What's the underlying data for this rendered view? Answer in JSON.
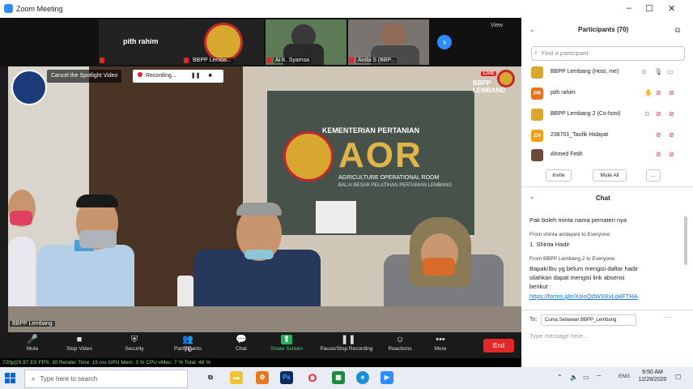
{
  "window": {
    "title": "Zoom Meeting",
    "minimize": "–",
    "maximize": "☐",
    "close": "✕"
  },
  "strip": {
    "tiles": [
      {
        "name": "pith rahim"
      },
      {
        "name": "BBPP Lemba..."
      },
      {
        "name": "Ai K. Syamsa"
      },
      {
        "name": "Anda S (BBP..."
      }
    ],
    "view_label": "View",
    "next_arrow": "›"
  },
  "main": {
    "spotlight_label": "Cancel the Spotlight Video",
    "recording_label": "Recording...",
    "live_badge": "LIVE",
    "brand": "BBPP LEMBANG",
    "speaker_name": "BBPP Lembang",
    "banner": {
      "ministry": "KEMENTERIAN PERTANIAN",
      "aor": "AOR",
      "subtitle": "AGRICULTURE OPERATIONAL ROOM",
      "location": "BALAI BESAR PELATIHAN PERTANIAN LEMBANG"
    }
  },
  "toolbar": {
    "items": [
      {
        "label": "Mute",
        "icon": "🎤"
      },
      {
        "label": "Stop Video",
        "icon": "■"
      },
      {
        "label": "Security",
        "icon": "⛨"
      },
      {
        "label": "Participants",
        "icon": "👥",
        "count": "70"
      },
      {
        "label": "Chat",
        "icon": "💬"
      },
      {
        "label": "Share Screen",
        "icon": "⬆"
      },
      {
        "label": "Pause/Stop Recording",
        "icon": "❚❚"
      },
      {
        "label": "Reactions",
        "icon": "☺"
      },
      {
        "label": "More",
        "icon": "•••"
      }
    ],
    "end_label": "End"
  },
  "stats": "720p|29.97   EX  FPS:  30   Render Time:  15 ms   GPU Mem:  3 %   CPU vMec:  7 %   Total:  48 %",
  "participants": {
    "header": "Participants (70)",
    "search_placeholder": "Find a participant",
    "list": [
      {
        "initials": "",
        "name": "BBPP Lembang (Host, me)",
        "color": "#d7a730"
      },
      {
        "initials": "PR",
        "name": "pith rahim",
        "color": "#e8731a"
      },
      {
        "initials": "",
        "name": "BBPP Lembang 2 (Co-host)",
        "color": "#d7a730"
      },
      {
        "initials": "ZH",
        "name": "238701_Taufik Hidayat",
        "color": "#f0a010"
      },
      {
        "initials": "",
        "name": "Ahmed Fetih",
        "color": "#6a4a3a"
      }
    ],
    "invite_label": "Invite",
    "mute_all_label": "Mute All",
    "more_label": "..."
  },
  "chat": {
    "header": "Chat",
    "messages": [
      {
        "from": "",
        "text": "Pak boleh minta nama pemateri nya"
      },
      {
        "from": "From shinta andayani to Everyone:",
        "text": "1. Shinta Hadir"
      },
      {
        "from": "From BBPP Lembang 2 to Everyone:",
        "lines": [
          "Bapak/Ibu yg belum mengisi daftar hadir",
          "silahkan dapat mengisi link absensi",
          "berikut :"
        ],
        "link": "https://forms.gle/XoIoQdWXKvLd4FTHA"
      }
    ],
    "to_label": "To:",
    "to_value": "Cuma Setiawan BBPP_Lembang",
    "input_placeholder": "Type message here..."
  },
  "taskbar": {
    "search_placeholder": "Type here to search",
    "lang": "ENG",
    "time": "9:50 AM",
    "date": "12/28/2020"
  }
}
